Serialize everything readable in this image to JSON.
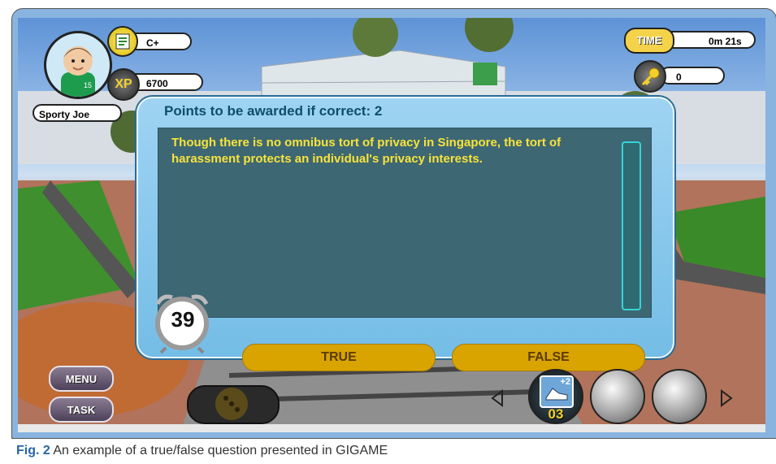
{
  "player": {
    "name": "Sporty Joe",
    "jersey_number": "15",
    "grade": "C+",
    "xp_label": "XP",
    "xp": "6700"
  },
  "hud": {
    "time_label": "TIME",
    "time_value": "0m 21s",
    "keys": "0"
  },
  "question": {
    "points_heading": "Points to be awarded if correct: 2",
    "text": "Though there is no omnibus tort of privacy in Singapore, the tort of harassment protects an individual's privacy interests.",
    "countdown": "39",
    "answers": [
      "TRUE",
      "FALSE"
    ]
  },
  "menu": {
    "menu_label": "MENU",
    "task_label": "TASK"
  },
  "powerups": {
    "boost_label": "+2",
    "count": "03"
  },
  "caption": {
    "label": "Fig. 2",
    "text": "An example of a true/false question presented in GIGAME"
  },
  "colors": {
    "dialog_bg": "#8ccbed",
    "panel_bg": "#3e6774",
    "question_text": "#f7e43a",
    "answer_button": "#d9a400",
    "caption_label": "#2766a8"
  },
  "icons": [
    "notepad-icon",
    "xp-icon",
    "key-icon",
    "alarm-clock-icon",
    "shoe-icon",
    "dice-icon",
    "arrow-left-icon",
    "arrow-right-icon"
  ]
}
